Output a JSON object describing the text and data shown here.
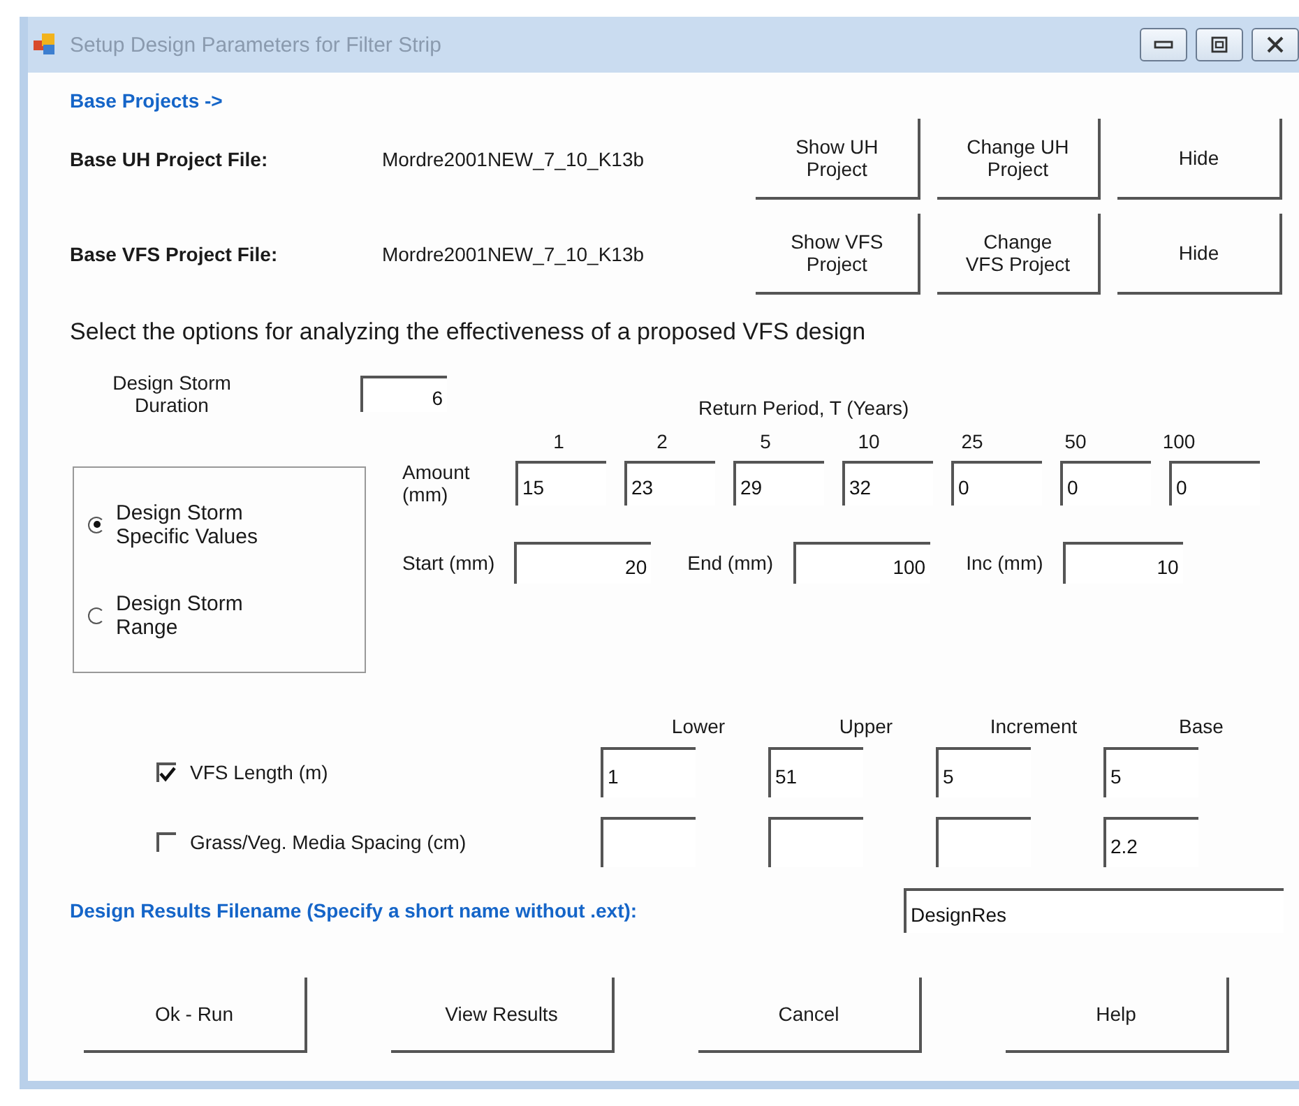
{
  "window": {
    "title": "Setup Design Parameters for Filter Strip"
  },
  "base_projects_label": "Base Projects ->",
  "project_files": [
    {
      "label": "Base UH Project File:",
      "file": "Mordre2001NEW_7_10_K13b",
      "buttons": [
        "Show UH Project",
        "Change UH Project",
        "Hide"
      ]
    },
    {
      "label": "Base VFS Project File:",
      "file": "Mordre2001NEW_7_10_K13b",
      "buttons": [
        "Show VFS Project",
        "Change VFS Project",
        "Hide"
      ]
    }
  ],
  "instruction": "Select the options for analyzing the effectiveness of a proposed VFS design",
  "duration": {
    "label": "Design Storm Duration",
    "value": "6"
  },
  "return_period": {
    "title": "Return Period, T (Years)",
    "columns": [
      "1",
      "2",
      "5",
      "10",
      "25",
      "50",
      "100"
    ]
  },
  "storm_options": [
    {
      "label": "Design Storm Specific Values",
      "selected": true
    },
    {
      "label": "Design Storm Range",
      "selected": false
    }
  ],
  "amount": {
    "label": "Amount (mm)",
    "values": [
      "15",
      "23",
      "29",
      "32",
      "0",
      "0",
      "0"
    ]
  },
  "range": [
    {
      "label": "Start (mm)",
      "value": "20"
    },
    {
      "label": "End (mm)",
      "value": "100"
    },
    {
      "label": "Inc (mm)",
      "value": "10"
    }
  ],
  "range_columns": [
    "Lower",
    "Upper",
    "Increment",
    "Base"
  ],
  "parameters": [
    {
      "label": "VFS Length (m)",
      "checked": true,
      "lower": "1",
      "upper": "51",
      "increment": "5",
      "base": "5"
    },
    {
      "label": "Grass/Veg. Media Spacing (cm)",
      "checked": false,
      "base": "2.2"
    }
  ],
  "filename": {
    "label": "Design Results Filename (Specify a short name without .ext):",
    "value": "DesignRes"
  },
  "buttons": [
    "Ok - Run",
    "View Results",
    "Cancel",
    "Help"
  ]
}
